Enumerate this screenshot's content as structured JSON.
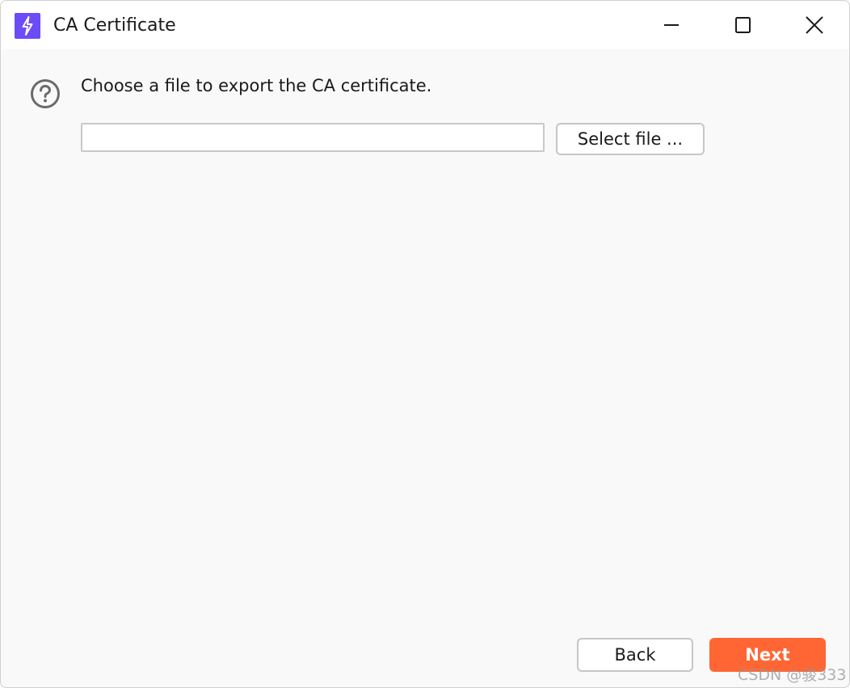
{
  "window": {
    "title": "CA Certificate",
    "icons": {
      "app": "lightning-bolt-icon",
      "minimize": "minimize-icon",
      "maximize": "maximize-icon",
      "close": "close-icon",
      "help": "question-circle-icon"
    }
  },
  "content": {
    "prompt": "Choose a file to export the CA certificate.",
    "file_input": {
      "value": "",
      "placeholder": ""
    },
    "select_file_label": "Select file ..."
  },
  "footer": {
    "back_label": "Back",
    "next_label": "Next"
  },
  "watermark": "CSDN @骏333",
  "colors": {
    "app_icon_bg": "#6b4cf6",
    "next_button_bg": "#ff6633"
  }
}
